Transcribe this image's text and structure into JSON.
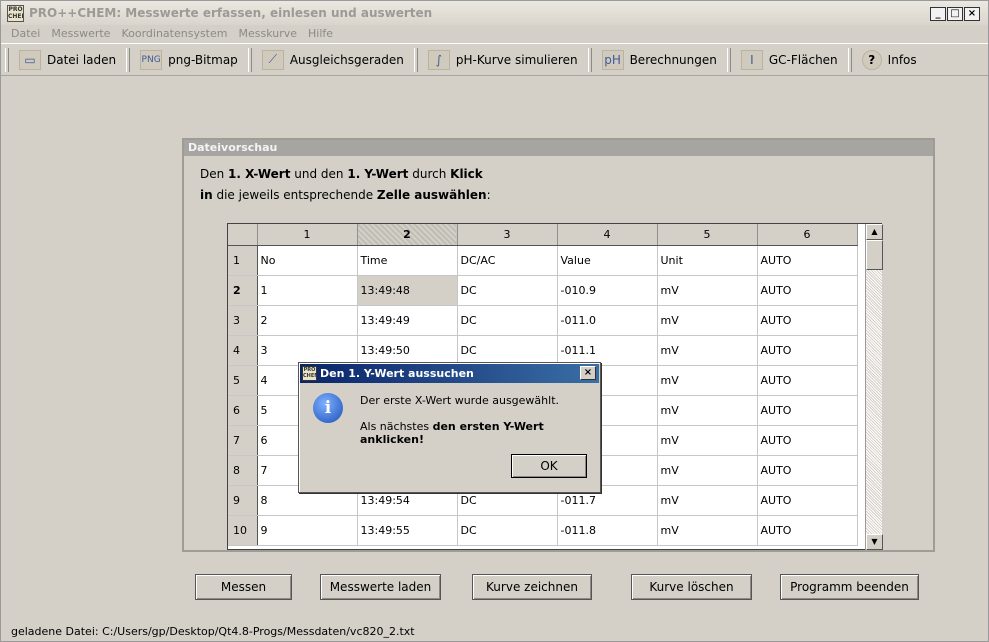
{
  "window": {
    "title": "PRO++CHEM: Messwerte erfassen, einlesen und auswerten",
    "icon_label": "PRO CHEM",
    "minimize": "_",
    "maximize": "□",
    "close": "×"
  },
  "menu": [
    "Datei",
    "Messwerte",
    "Koordinatensystem",
    "Messkurve",
    "Hilfe"
  ],
  "toolbar": [
    {
      "label": "Datei laden",
      "icon": "folder-icon",
      "glyph": "▭"
    },
    {
      "label": "png-Bitmap",
      "icon": "png-icon",
      "glyph": "PNG"
    },
    {
      "label": "Ausgleichsgeraden",
      "icon": "regression-line-icon",
      "glyph": "⟋"
    },
    {
      "label": "pH-Kurve simulieren",
      "icon": "titration-curve-icon",
      "glyph": "∫"
    },
    {
      "label": "Berechnungen",
      "icon": "ph-icon",
      "glyph": "pH"
    },
    {
      "label": "GC-Flächen",
      "icon": "integral-icon",
      "glyph": "I"
    },
    {
      "label": "Infos",
      "icon": "help-icon",
      "glyph": "?"
    }
  ],
  "panel": {
    "title": "Dateivorschau",
    "instr_a": "Den ",
    "instr_b": "1. X-Wert",
    "instr_c": " und den ",
    "instr_d": "1. Y-Wert",
    "instr_e": " durch ",
    "instr_f": "Klick",
    "instr_g": "in",
    "instr_h": " die jeweils entsprechende ",
    "instr_i": "Zelle auswählen",
    "instr_j": ":"
  },
  "table": {
    "columns": [
      "1",
      "2",
      "3",
      "4",
      "5",
      "6"
    ],
    "selected_column": "2",
    "rows": [
      {
        "h": "1",
        "c": [
          "No",
          "Time",
          "DC/AC",
          "Value",
          "Unit",
          "AUTO"
        ]
      },
      {
        "h": "2",
        "c": [
          "1",
          "13:49:48",
          "DC",
          "-010.9",
          "mV",
          "AUTO"
        ]
      },
      {
        "h": "3",
        "c": [
          "2",
          "13:49:49",
          "DC",
          "-011.0",
          "mV",
          "AUTO"
        ]
      },
      {
        "h": "4",
        "c": [
          "3",
          "13:49:50",
          "DC",
          "-011.1",
          "mV",
          "AUTO"
        ]
      },
      {
        "h": "5",
        "c": [
          "4",
          "",
          "",
          "",
          "mV",
          "AUTO"
        ]
      },
      {
        "h": "6",
        "c": [
          "5",
          "",
          "",
          "",
          "mV",
          "AUTO"
        ]
      },
      {
        "h": "7",
        "c": [
          "6",
          "",
          "",
          "",
          "mV",
          "AUTO"
        ]
      },
      {
        "h": "8",
        "c": [
          "7",
          "",
          "",
          "",
          "mV",
          "AUTO"
        ]
      },
      {
        "h": "9",
        "c": [
          "8",
          "13:49:54",
          "DC",
          "-011.7",
          "mV",
          "AUTO"
        ]
      },
      {
        "h": "10",
        "c": [
          "9",
          "13:49:55",
          "DC",
          "-011.8",
          "mV",
          "AUTO"
        ]
      }
    ],
    "scroll_up": "▲",
    "scroll_down": "▼"
  },
  "buttons": [
    "Messen",
    "Messwerte laden",
    "Kurve zeichnen",
    "Kurve löschen",
    "Programm beenden"
  ],
  "status": "geladene Datei:  C:/Users/gp/Desktop/Qt4.8-Progs/Messdaten/vc820_2.txt",
  "dialog": {
    "title": "Den 1. Y-Wert aussuchen",
    "icon_glyph": "i",
    "close": "×",
    "line1": "Der erste X-Wert wurde ausgewählt.",
    "line2a": "Als nächstes ",
    "line2b": "den ersten Y-Wert anklicken!",
    "ok": "OK"
  }
}
